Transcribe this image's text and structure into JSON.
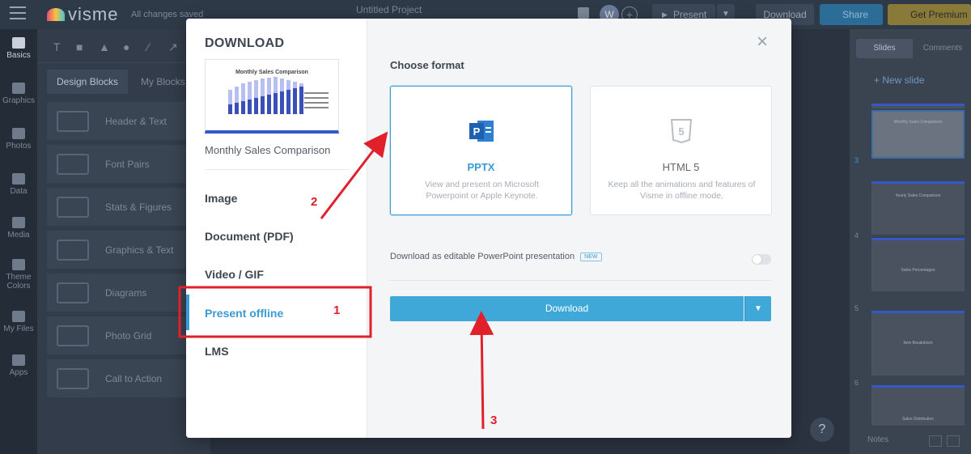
{
  "topbar": {
    "logo": "visme",
    "saved_status": "All changes saved",
    "project_title": "Untitled Project",
    "avatar_initial": "W",
    "present_label": "Present",
    "download_label": "Download",
    "share_label": "Share",
    "premium_label": "Get Premium"
  },
  "sidebar": {
    "items": [
      {
        "label": "Basics"
      },
      {
        "label": "Graphics"
      },
      {
        "label": "Photos"
      },
      {
        "label": "Data"
      },
      {
        "label": "Media"
      },
      {
        "label": "Theme Colors"
      },
      {
        "label": "My Files"
      },
      {
        "label": "Apps"
      }
    ]
  },
  "panel": {
    "tabs": [
      "Design Blocks",
      "My Blocks"
    ],
    "blocks": [
      "Header & Text",
      "Font Pairs",
      "Stats & Figures",
      "Graphics & Text",
      "Diagrams",
      "Photo Grid",
      "Call to Action"
    ]
  },
  "right_panel": {
    "tabs": [
      "Slides",
      "Comments"
    ],
    "new_slide": "+ New slide",
    "slides": [
      {
        "num": "",
        "title": ""
      },
      {
        "num": "3",
        "title": "Monthly Sales Comparison"
      },
      {
        "num": "",
        "title": "Yearly Sales Comparison"
      },
      {
        "num": "4",
        "title": "Sales Percentages"
      },
      {
        "num": "5",
        "title": "Item Breakdown"
      },
      {
        "num": "6",
        "title": "Sales Distribution"
      }
    ],
    "notes_label": "Notes",
    "help_label": "?"
  },
  "modal": {
    "title": "DOWNLOAD",
    "preview_title": "Monthly Sales Comparison",
    "preview_name": "Monthly Sales Comparison",
    "menu": [
      "Image",
      "Document (PDF)",
      "Video / GIF",
      "Present offline",
      "LMS"
    ],
    "active_menu": "Present offline",
    "choose_format": "Choose format",
    "formats": [
      {
        "name": "PPTX",
        "desc": "View and present on Microsoft Powerpoint or Apple Keynote.",
        "icon": "powerpoint-icon"
      },
      {
        "name": "HTML 5",
        "desc": "Keep all the animations and features of Visme in offline mode.",
        "icon": "html5-icon"
      }
    ],
    "editable_label": "Download as editable PowerPoint presentation",
    "new_badge": "NEW",
    "download_button": "Download",
    "close_icon": "close-icon"
  },
  "annotations": {
    "labels": [
      "1",
      "2",
      "3"
    ],
    "color": "#e0212b"
  },
  "colors": {
    "accent": "#3a9bd5",
    "download_button": "#3fa8d8"
  }
}
